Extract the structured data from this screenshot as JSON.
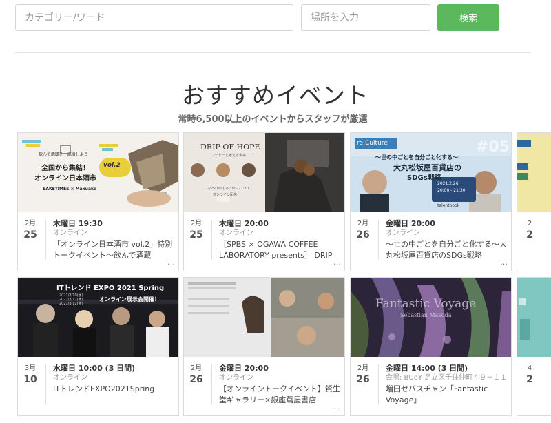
{
  "search": {
    "keyword_placeholder": "カテゴリー/ワード",
    "location_placeholder": "場所を入力",
    "button_label": "検索"
  },
  "section": {
    "title": "おすすめイベント",
    "subtitle": "常時6,500以上のイベントからスタッフが厳選"
  },
  "events": [
    {
      "month": "2月",
      "day": "25",
      "when": "木曜日 19:30",
      "where": "オンライン",
      "title": "「オンライン日本酒市 vol.2」特別トークイベント〜飲んで酒蔵",
      "thumb_text": [
        "飲んで酒蔵を",
        "応援しよう",
        "全国から集結！",
        "オンライン日本酒市",
        "vol.2",
        "SAKETIMES",
        "Makuake"
      ]
    },
    {
      "month": "2月",
      "day": "25",
      "when": "木曜日 20:00",
      "where": "オンライン",
      "title": "［SPBS × OGAWA COFFEE LABORATORY presents］ DRIP",
      "thumb_text": [
        "DRIP OF HOPE",
        "コーヒーと考える未来",
        "2/25(Thu) 20:00 - 21:30",
        "オンライン配信"
      ]
    },
    {
      "month": "2月",
      "day": "26",
      "when": "金曜日 20:00",
      "where": "オンライン",
      "title": "〜世の中ごとを自分ごと化する〜大丸松坂屋百貨店のSDGs戦略",
      "thumb_text": [
        "re:Culture",
        "〜世の中ごとを自分ごと化する〜",
        "大丸松坂屋百貨店の",
        "SDGs戦略",
        "#05",
        "2021.2.26",
        "20:00 - 21:30",
        "talentbook"
      ]
    },
    {
      "month": "3月",
      "day": "10",
      "when": "水曜日 10:00 (3 日間)",
      "where": "オンライン",
      "title": "ITトレンドEXPO2021Spring",
      "thumb_text": [
        "ITトレンド EXPO 2021 Spring",
        "2021/3/10(水)",
        "2021/3/11(木)",
        "2021/3/12(金)",
        "オンライン展示会開催！"
      ]
    },
    {
      "month": "2月",
      "day": "26",
      "when": "金曜日 20:00",
      "where": "オンライン",
      "title": "【オンライントークイベント】資生堂ギャラリー×銀座蔦屋書店",
      "thumb_text": []
    },
    {
      "month": "2月",
      "day": "26",
      "when": "金曜日 14:00 (3 日間)",
      "where": "会場: BUoY 足立区千住仲町４９－１１",
      "title": "増田セバスチャン「Fantastic Voyage」",
      "thumb_text": [
        "Fantastic Voyage",
        "Sebastian Masuda"
      ]
    }
  ],
  "partial_cards": [
    {
      "month": "2",
      "day": "2"
    },
    {
      "month": "4",
      "day": "2"
    }
  ],
  "ellipsis": "…",
  "colors": {
    "accent_green": "#5cb85c",
    "text_main": "#333333",
    "text_muted": "#999999",
    "border": "#dcdcdc"
  }
}
